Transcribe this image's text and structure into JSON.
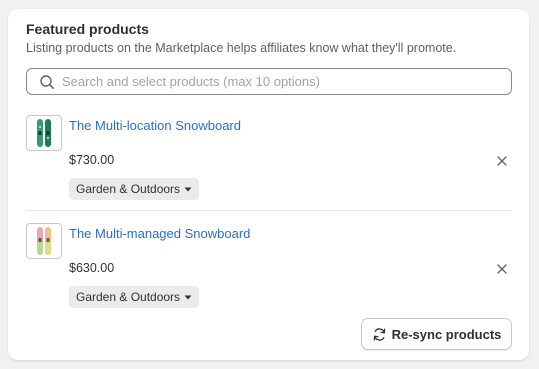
{
  "card": {
    "title": "Featured products",
    "subtitle": "Listing products on the Marketplace helps affiliates know what they'll promote."
  },
  "search": {
    "placeholder": "Search and select products (max 10 options)",
    "value": ""
  },
  "products": [
    {
      "name": "The Multi-location Snowboard",
      "price": "$730.00",
      "category": "Garden & Outdoors",
      "thumb_icon": "snowboard-green-icon"
    },
    {
      "name": "The Multi-managed Snowboard",
      "price": "$630.00",
      "category": "Garden & Outdoors",
      "thumb_icon": "snowboard-pastel-icon"
    }
  ],
  "actions": {
    "resync_label": "Re-sync products",
    "resync_icon": "refresh-icon"
  },
  "colors": {
    "link": "#2c6ecb",
    "text": "#303030",
    "muted": "#616161",
    "tag_bg": "#ebebeb"
  }
}
